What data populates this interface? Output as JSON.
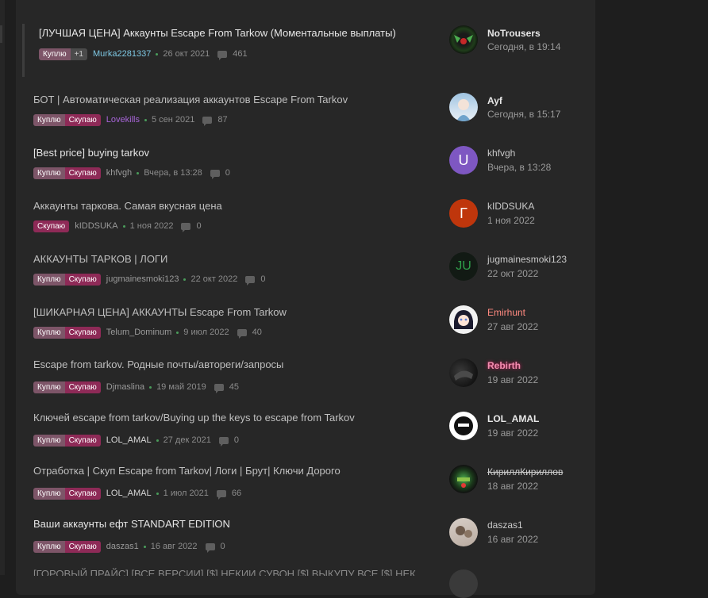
{
  "threads": [
    {
      "title": "[ЛУЧШАЯ ЦЕНА] Аккаунты Escape From Tarkow (Моментальные выплаты)",
      "labels": [
        "Куплю",
        "+1"
      ],
      "author": "Murka2281337",
      "date": "26 окт 2021",
      "replies": "461",
      "last_user": "NoTrousers",
      "last_date": "Сегодня, в 19:14",
      "avatar_letter": ""
    },
    {
      "title": "БОТ | Автоматическая реализация аккаунтов Escape From Tarkov",
      "labels": [
        "Куплю",
        "Скупаю"
      ],
      "author": "Lovekills",
      "date": "5 сен 2021",
      "replies": "87",
      "last_user": "Ayf",
      "last_date": "Сегодня, в 15:17",
      "avatar_letter": ""
    },
    {
      "title": "[Best price] buying tarkov",
      "labels": [
        "Куплю",
        "Скупаю"
      ],
      "author": "khfvgh",
      "date": "Вчера, в 13:28",
      "replies": "0",
      "last_user": "khfvgh",
      "last_date": "Вчера, в 13:28",
      "avatar_letter": "U"
    },
    {
      "title": "Аккаунты таркова. Самая вкусная цена",
      "labels": [
        "Скупаю"
      ],
      "author": "kIDDSUKA",
      "date": "1 ноя 2022",
      "replies": "0",
      "last_user": "kIDDSUKA",
      "last_date": "1 ноя 2022",
      "avatar_letter": "Г"
    },
    {
      "title": "АККАУНТЫ ТАРКОВ | ЛОГИ",
      "labels": [
        "Куплю",
        "Скупаю"
      ],
      "author": "jugmainesmoki123",
      "date": "22 окт 2022",
      "replies": "0",
      "last_user": "jugmainesmoki123",
      "last_date": "22 окт 2022",
      "avatar_letter": "JU"
    },
    {
      "title": "[ШИКАРНАЯ ЦЕНА] АККАУНТЫ Escape From Tarkow",
      "labels": [
        "Куплю",
        "Скупаю"
      ],
      "author": "Telum_Dominum",
      "date": "9 июл 2022",
      "replies": "40",
      "last_user": "Emirhunt",
      "last_date": "27 авг 2022",
      "avatar_letter": ""
    },
    {
      "title": "Escape from tarkov. Родные почты/автореги/запросы",
      "labels": [
        "Куплю",
        "Скупаю"
      ],
      "author": "Djmaslina",
      "date": "19 май 2019",
      "replies": "45",
      "last_user": "Rebirth",
      "last_date": "19 авг 2022",
      "avatar_letter": ""
    },
    {
      "title": "Ключей escape from tarkov/Buying up the keys to escape from Tarkov",
      "labels": [
        "Куплю",
        "Скупаю"
      ],
      "author": "LOL_AMAL",
      "date": "27 дек 2021",
      "replies": "0",
      "last_user": "LOL_AMAL",
      "last_date": "19 авг 2022",
      "avatar_letter": ""
    },
    {
      "title": "Отработка | Скуп Escape from Tarkov| Логи | Брут| Ключи Дорого",
      "labels": [
        "Куплю",
        "Скупаю"
      ],
      "author": "LOL_AMAL",
      "date": "1 июл 2021",
      "replies": "66",
      "last_user": "КириллКириллов",
      "last_date": "18 авг 2022",
      "avatar_letter": ""
    },
    {
      "title": "Ваши аккаунты ефт STANDART EDITION",
      "labels": [
        "Куплю",
        "Скупаю"
      ],
      "author": "daszas1",
      "date": "16 авг 2022",
      "replies": "0",
      "last_user": "daszas1",
      "last_date": "16 авг 2022",
      "avatar_letter": ""
    }
  ],
  "partial_row_text": "[ГОРОВЫЙ ПРАЙС] [ВСЕ ВЕРСИИ] [$] НЕКИИ СУВОН [$] ВЫКУПУ ВСЕ [$] НЕК",
  "colors": {
    "label_buy": "#7d5568",
    "label_sell": "#8e2a57",
    "accent_blue": "#7ec8e3",
    "accent_purple": "#a765d8",
    "dot_green": "#4a9d5b"
  }
}
